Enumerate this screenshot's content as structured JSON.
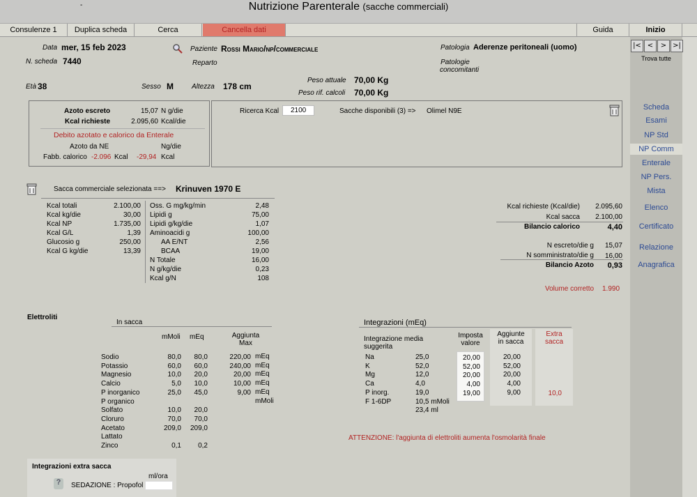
{
  "app": {
    "title": "Nutrizione Parenterale",
    "subtitle": "(sacche commerciali)",
    "dash": "-"
  },
  "tabs": [
    "Consulenze 1",
    "Duplica scheda",
    "Cerca",
    "Cancella dati",
    "Guida",
    "Inizio"
  ],
  "patient": {
    "data_label": "Data",
    "data": "mer, 15 feb 2023",
    "scheda_label": "N. scheda",
    "scheda": "7440",
    "paziente_label": "Paziente",
    "paziente": "Rossi Mario/np/commerciale",
    "reparto_label": "Reparto",
    "patologia_label": "Patologia",
    "patologia": "Aderenze peritoneali (uomo)",
    "conc_label1": "Patologie",
    "conc_label2": "concomitanti",
    "peso_att_label": "Peso attuale",
    "peso_att": "70,00 Kg",
    "peso_rif_label": "Peso rif. calcoli",
    "peso_rif": "70,00 Kg",
    "eta_label": "Età",
    "eta": "38",
    "sesso_label": "Sesso",
    "sesso": "M",
    "altezza_label": "Altezza",
    "altezza": "178 cm"
  },
  "azoto": {
    "escreto_label": "Azoto escreto",
    "escreto": "15,07",
    "escreto_unit": "N g/die",
    "kcal_label": "Kcal richieste",
    "kcal": "2.095,60",
    "kcal_unit": "Kcal/die",
    "debito": "Debito azotato e calorico da Enterale",
    "ne_label": "Azoto da NE",
    "ne_unit": "Ng/die",
    "fabb_label": "Fabb. calorico",
    "fabb": "-2.096",
    "fabb_unit": "Kcal",
    "fabb2": "-29,94",
    "fabb2_unit": "Kcal"
  },
  "ricerca": {
    "label": "Ricerca Kcal",
    "value": "2100",
    "sacche": "Sacche disponibili (3) =>",
    "sacca": "Olimel N9E"
  },
  "sacca": {
    "label": "Sacca commerciale selezionata ==>",
    "name": "Krinuven 1970 E"
  },
  "col1": [
    {
      "l": "Kcal totali",
      "v": "2.100,00"
    },
    {
      "l": "Kcal kg/die",
      "v": "30,00"
    },
    {
      "l": "Kcal NP",
      "v": "1.735,00"
    },
    {
      "l": "Kcal G/L",
      "v": "1,39"
    },
    {
      "l": "Glucosio g",
      "v": "250,00"
    },
    {
      "l": "Kcal G kg/die",
      "v": "13,39"
    }
  ],
  "col2": [
    {
      "l": "Oss. G mg/kg/min",
      "v": "2,48"
    },
    {
      "l": "Lipidi g",
      "v": "75,00"
    },
    {
      "l": "Lipidi g/kg/die",
      "v": "1,07"
    },
    {
      "l": "Aminoacidi g",
      "v": "100,00"
    },
    {
      "l": "AA E/NT",
      "v": "2,56"
    },
    {
      "l": "BCAA",
      "v": "19,00"
    },
    {
      "l": "N Totale",
      "v": "16,00"
    },
    {
      "l": "N g/kg/die",
      "v": "0,23"
    },
    {
      "l": "Kcal g/N",
      "v": "108"
    }
  ],
  "bilancio": {
    "kr_label": "Kcal richieste (Kcal/die)",
    "kr": "2.095,60",
    "ks_label": "Kcal sacca",
    "ks": "2.100,00",
    "bc_label": "Bilancio calorico",
    "bc": "4,40",
    "ne_label": "N escreto/die g",
    "ne": "15,07",
    "ns_label": "N somministrato/die g",
    "ns": "16,00",
    "ba_label": "Bilancio Azoto",
    "ba": "0,93",
    "vol_label": "Volume corretto",
    "vol": "1.990"
  },
  "elettroliti": {
    "title": "Elettroliti",
    "in_sacca": "In sacca",
    "h_mmoli": "mMoli",
    "h_meq": "mEq",
    "h_agg1": "Aggiunta",
    "h_agg2": "Max",
    "rows": [
      {
        "n": "Sodio",
        "mm": "80,0",
        "me": "80,0",
        "ag": "220,00",
        "u": "mEq"
      },
      {
        "n": "Potassio",
        "mm": "60,0",
        "me": "60,0",
        "ag": "240,00",
        "u": "mEq"
      },
      {
        "n": "Magnesio",
        "mm": "10,0",
        "me": "20,0",
        "ag": "20,00",
        "u": "mEq"
      },
      {
        "n": "Calcio",
        "mm": "5,0",
        "me": "10,0",
        "ag": "10,00",
        "u": "mEq"
      },
      {
        "n": "P inorganico",
        "mm": "25,0",
        "me": "45,0",
        "ag": "9,00",
        "u": "mEq"
      },
      {
        "n": "P organico",
        "mm": "",
        "me": "",
        "ag": "",
        "u": "mMoli"
      },
      {
        "n": "Solfato",
        "mm": "10,0",
        "me": "20,0",
        "ag": "",
        "u": ""
      },
      {
        "n": "Cloruro",
        "mm": "70,0",
        "me": "70,0",
        "ag": "",
        "u": ""
      },
      {
        "n": "Acetato",
        "mm": "209,0",
        "me": "209,0",
        "ag": "",
        "u": ""
      },
      {
        "n": "Lattato",
        "mm": "",
        "me": "",
        "ag": "",
        "u": ""
      },
      {
        "n": "Zinco",
        "mm": "0,1",
        "me": "0,2",
        "ag": "",
        "u": ""
      }
    ]
  },
  "integrazioni": {
    "title": "Integrazioni (mEq)",
    "media1": "Integrazione media",
    "media2": "suggerita",
    "imp1": "Imposta",
    "imp2": "valore",
    "agg1": "Aggiunte",
    "agg2": "in sacca",
    "ext1": "Extra",
    "ext2": "sacca",
    "rows": [
      {
        "n": "Na",
        "s": "25,0",
        "i": "20,00",
        "a": "20,00",
        "e": ""
      },
      {
        "n": "K",
        "s": "52,0",
        "i": "52,00",
        "a": "52,00",
        "e": ""
      },
      {
        "n": "Mg",
        "s": "12,0",
        "i": "20,00",
        "a": "20,00",
        "e": ""
      },
      {
        "n": "Ca",
        "s": "4,0",
        "i": "4,00",
        "a": "4,00",
        "e": ""
      },
      {
        "n": "P inorg.",
        "s": "19,0",
        "i": "19,00",
        "a": "9,00",
        "e": "10,0"
      },
      {
        "n": "F 1-6DP",
        "s": "10,5 mMoli",
        "i": "",
        "a": "",
        "e": ""
      },
      {
        "n": "",
        "s": "23,4 ml",
        "i": "",
        "a": "",
        "e": ""
      }
    ],
    "attenzione": "ATTENZIONE: l'aggiunta di elettroliti aumenta l'osmolarità finale"
  },
  "extra": {
    "title": "Integrazioni extra sacca",
    "unit": "ml/ora",
    "sedazione": "SEDAZIONE : Propofol"
  },
  "side": {
    "trova": "Trova tutte",
    "links": [
      "Scheda",
      "Esami",
      "NP Std",
      "NP Comm",
      "Enterale",
      "NP Pers.",
      "Mista",
      "Elenco",
      "Certificato",
      "Relazione",
      "Anagrafica"
    ]
  },
  "colors": {
    "accent_red": "#b22222",
    "tab_red": "#e07a6c",
    "link_blue": "#2c4a94"
  }
}
